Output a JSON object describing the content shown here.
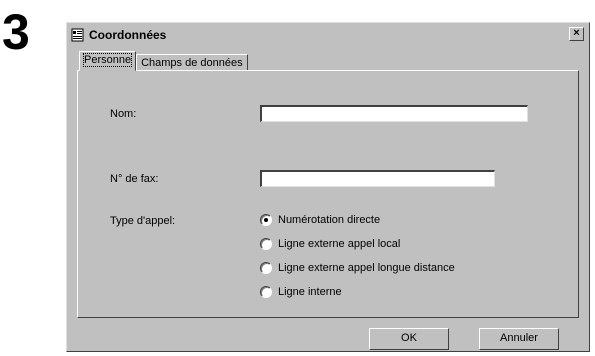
{
  "step_number": "3",
  "window": {
    "title": "Coordonnées",
    "close_symbol": "×",
    "icon": "address-book-icon"
  },
  "tabs": [
    {
      "label": "Personne",
      "active": true
    },
    {
      "label": "Champs de données",
      "active": false
    }
  ],
  "form": {
    "name_label": "Nom:",
    "name_value": "",
    "fax_label": "N° de fax:",
    "fax_value": "",
    "call_type_label": "Type d'appel:",
    "call_type_options": [
      {
        "label": "Numérotation directe",
        "checked": true
      },
      {
        "label": "Ligne externe appel local",
        "checked": false
      },
      {
        "label": "Ligne externe appel longue distance",
        "checked": false
      },
      {
        "label": "Ligne interne",
        "checked": false
      }
    ]
  },
  "buttons": {
    "ok_label": "OK",
    "cancel_label": "Annuler"
  }
}
